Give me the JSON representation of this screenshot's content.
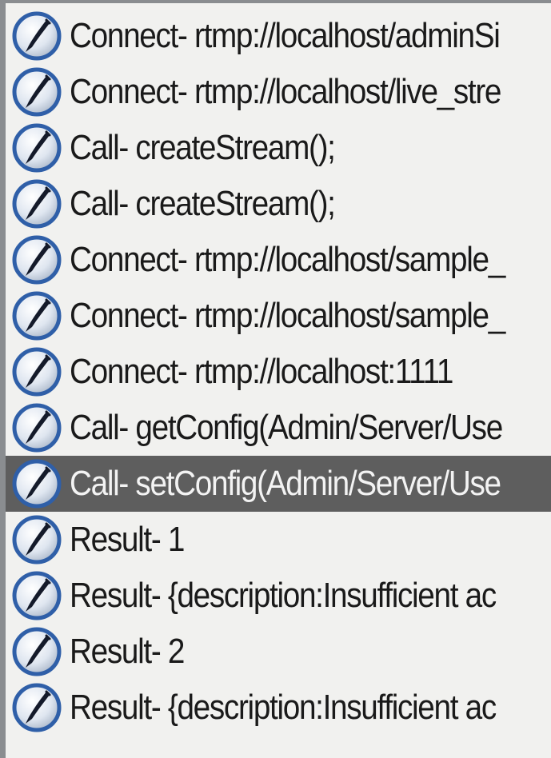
{
  "log": {
    "selected_index": 8,
    "entries": [
      {
        "text": "Connect- rtmp://localhost/adminSi",
        "icon": "quill-pen-icon"
      },
      {
        "text": "Connect- rtmp://localhost/live_stre",
        "icon": "quill-pen-icon"
      },
      {
        "text": "Call- createStream();",
        "icon": "quill-pen-icon"
      },
      {
        "text": "Call- createStream();",
        "icon": "quill-pen-icon"
      },
      {
        "text": "Connect- rtmp://localhost/sample_",
        "icon": "quill-pen-icon"
      },
      {
        "text": "Connect- rtmp://localhost/sample_",
        "icon": "quill-pen-icon"
      },
      {
        "text": "Connect- rtmp://localhost:1111",
        "icon": "quill-pen-icon"
      },
      {
        "text": "Call- getConfig(Admin/Server/Use",
        "icon": "quill-pen-icon"
      },
      {
        "text": "Call- setConfig(Admin/Server/Use",
        "icon": "quill-pen-icon"
      },
      {
        "text": "Result- 1",
        "icon": "quill-pen-icon"
      },
      {
        "text": "Result- {description:Insufficient ac",
        "icon": "quill-pen-icon"
      },
      {
        "text": "Result- 2",
        "icon": "quill-pen-icon"
      },
      {
        "text": "Result- {description:Insufficient ac",
        "icon": "quill-pen-icon"
      }
    ]
  },
  "colors": {
    "background": "#f1f1ef",
    "selected_row": "#5e5e5e",
    "icon_disc": "#2f5fa8",
    "text": "#1a1a1a"
  }
}
